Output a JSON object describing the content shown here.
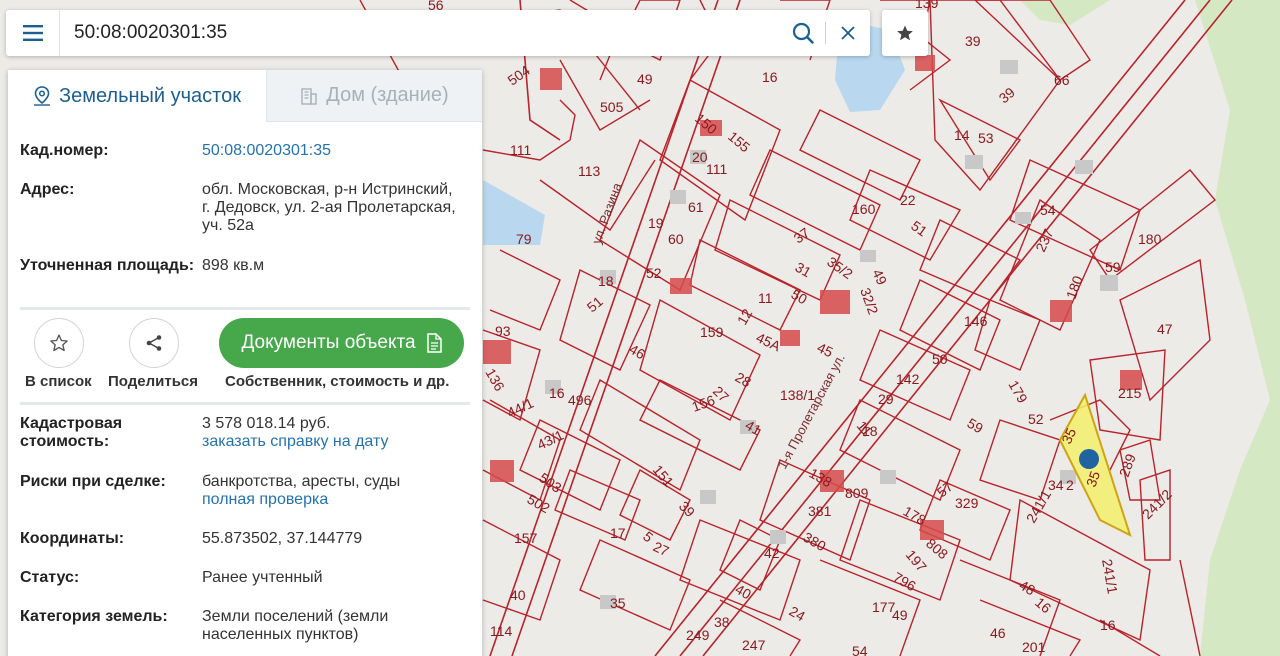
{
  "search": {
    "value": "50:08:0020301:35"
  },
  "tabs": [
    {
      "label": "Земельный участок",
      "active": true
    },
    {
      "label": "Дом (здание)",
      "active": false
    }
  ],
  "details": {
    "cad_number": {
      "label": "Кад.номер:",
      "value": "50:08:0020301:35"
    },
    "address": {
      "label": "Адрес:",
      "value": "обл. Московская, р-н Истринский, г. Дедовск, ул. 2-ая Пролетарская, уч. 52а"
    },
    "area": {
      "label": "Уточненная площадь:",
      "value": "898 кв.м"
    }
  },
  "actions": {
    "add_to_list": "В список",
    "share": "Поделиться",
    "documents_button": "Документы объекта",
    "documents_caption": "Собственник, стоимость и др."
  },
  "details2": {
    "cad_value": {
      "label": "Кадастровая стоимость:",
      "value": "3 578 018.14 руб.",
      "link": "заказать справку на дату"
    },
    "risks": {
      "label": "Риски при сделке:",
      "value": "банкротства, аресты, суды",
      "link": "полная проверка"
    },
    "coords": {
      "label": "Координаты:",
      "value": "55.873502, 37.144779"
    },
    "status": {
      "label": "Статус:",
      "value": "Ранее учтенный"
    },
    "category": {
      "label": "Категория земель:",
      "value": "Земли поселений (земли населенных пунктов)"
    }
  },
  "map": {
    "streets": [
      "ул. Разина",
      "1-я Пролетарская ул."
    ],
    "parcel_labels": [
      "139",
      "56",
      "504",
      "49",
      "505",
      "16",
      "111",
      "113",
      "150",
      "155",
      "20",
      "111",
      "79",
      "19",
      "60",
      "61",
      "160",
      "22",
      "51",
      "37",
      "35/2",
      "32/2",
      "49",
      "31",
      "50",
      "18",
      "51",
      "52",
      "11",
      "12",
      "45А",
      "45",
      "46",
      "159",
      "27",
      "28",
      "138/1",
      "156",
      "41",
      "93",
      "136",
      "16",
      "496",
      "44/1",
      "43/1",
      "151",
      "39",
      "503",
      "502",
      "157",
      "40",
      "114",
      "249",
      "38",
      "247",
      "35",
      "42",
      "40",
      "24",
      "177",
      "49",
      "54",
      "17",
      "5",
      "27",
      "138",
      "809",
      "381",
      "380",
      "178",
      "808",
      "197",
      "796",
      "11",
      "18",
      "142",
      "29",
      "50",
      "59",
      "146",
      "179",
      "57",
      "329",
      "52",
      "39",
      "66",
      "39",
      "14",
      "53",
      "54",
      "237",
      "180",
      "59",
      "180",
      "47",
      "215",
      "35",
      "35",
      "34",
      "2",
      "289",
      "241/2",
      "241/1",
      "241/1",
      "48",
      "16",
      "46",
      "201",
      "16"
    ],
    "colors": {
      "parcel_line": "#b9232b",
      "highlight_fill": "#f3f06b",
      "highlight_stroke": "#d0a315",
      "marker": "#1f63a3",
      "water": "#b9d8f0",
      "forest": "#d4e8c3"
    }
  }
}
